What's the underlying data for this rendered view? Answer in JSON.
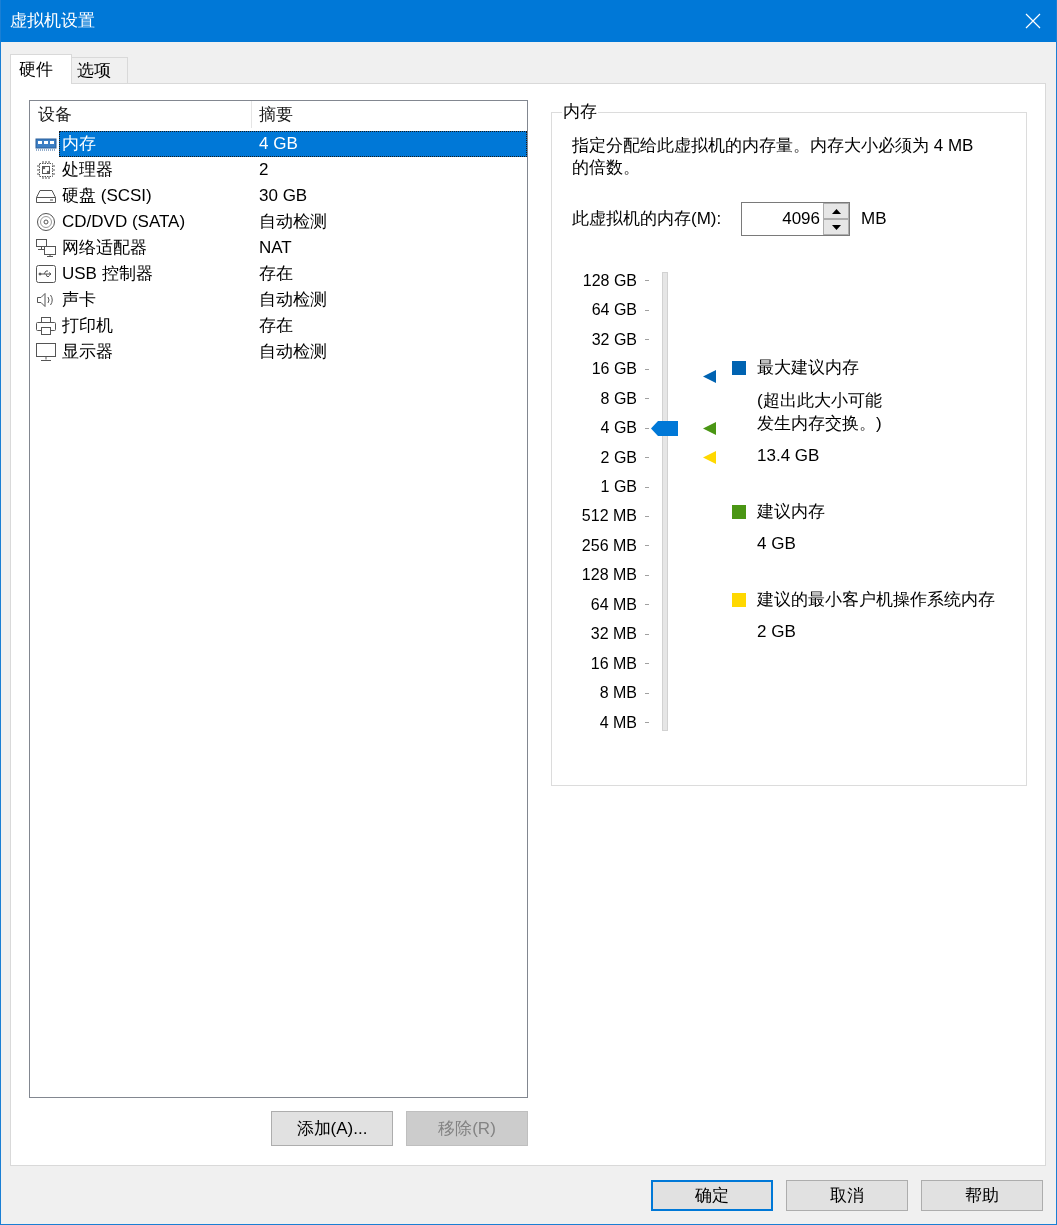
{
  "window": {
    "title": "虚拟机设置"
  },
  "tabs": [
    {
      "label": "硬件",
      "selected": true
    },
    {
      "label": "选项",
      "selected": false
    }
  ],
  "device_list": {
    "columns": [
      "设备",
      "摘要"
    ],
    "rows": [
      {
        "kind": "memory",
        "name": "内存",
        "summary": "4 GB",
        "selected": true
      },
      {
        "kind": "processor",
        "name": "处理器",
        "summary": "2",
        "selected": false
      },
      {
        "kind": "disk",
        "name": "硬盘 (SCSI)",
        "summary": "30 GB",
        "selected": false
      },
      {
        "kind": "disc",
        "name": "CD/DVD (SATA)",
        "summary": "自动检测",
        "selected": false
      },
      {
        "kind": "network",
        "name": "网络适配器",
        "summary": "NAT",
        "selected": false
      },
      {
        "kind": "usb",
        "name": "USB 控制器",
        "summary": "存在",
        "selected": false
      },
      {
        "kind": "sound",
        "name": "声卡",
        "summary": "自动检测",
        "selected": false
      },
      {
        "kind": "printer",
        "name": "打印机",
        "summary": "存在",
        "selected": false
      },
      {
        "kind": "display",
        "name": "显示器",
        "summary": "自动检测",
        "selected": false
      }
    ]
  },
  "device_buttons": [
    {
      "label": "添加(A)...",
      "disabled": false
    },
    {
      "label": "移除(R)",
      "disabled": true
    }
  ],
  "memory": {
    "title": "内存",
    "description": "指定分配给此虚拟机的内存量。内存大小必须为 4 MB 的倍数。",
    "input_label": "此虚拟机的内存(M):",
    "value": "4096",
    "unit": "MB",
    "slider": {
      "ticks": [
        "128 GB",
        "64 GB",
        "32 GB",
        "16 GB",
        "8 GB",
        "4 GB",
        "2 GB",
        "1 GB",
        "512 MB",
        "256 MB",
        "128 MB",
        "64 MB",
        "32 MB",
        "16 MB",
        "8 MB",
        "4 MB"
      ],
      "level": 0.667,
      "markers": [
        {
          "color": "#0063b1",
          "level": 0.783
        },
        {
          "color": "#4a9614",
          "level": 0.667
        },
        {
          "color": "#ffd800",
          "level": 0.6
        }
      ]
    },
    "legend": [
      {
        "color": "#0063b1",
        "label": "最大建议内存",
        "note": "(超出此大小可能发生内存交换。)",
        "value": "13.4 GB"
      },
      {
        "color": "#4a9614",
        "label": "建议内存",
        "value": "4 GB"
      },
      {
        "color": "#ffd800",
        "label": "建议的最小客户机操作系统内存",
        "value": "2 GB"
      }
    ]
  },
  "dialog_buttons": [
    {
      "label": "确定",
      "default": true
    },
    {
      "label": "取消",
      "default": false
    },
    {
      "label": "帮助",
      "default": false
    }
  ]
}
